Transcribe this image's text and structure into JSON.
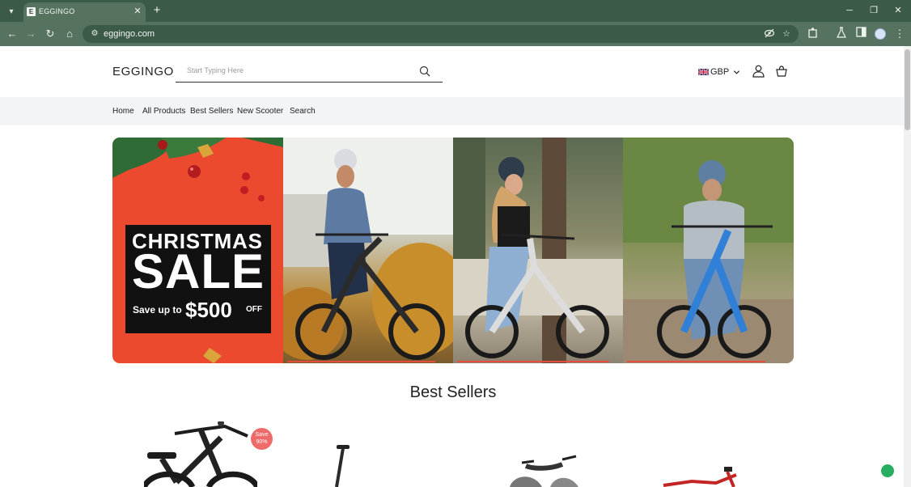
{
  "browser": {
    "tab_title": "EGGINGO",
    "url": "eggingo.com"
  },
  "site": {
    "logo": "EGGINGO",
    "search_placeholder": "Start Typing Here",
    "currency": "GBP",
    "nav": [
      "Home",
      "All Products",
      "Best Sellers",
      "New Scooter",
      "Search"
    ]
  },
  "hero": {
    "headline": "CHRISTMAS",
    "headline2": "SALE",
    "save_up_to": "Save up to",
    "amount": "$500",
    "off": "OFF"
  },
  "best_sellers": {
    "title": "Best Sellers",
    "badge_line1": "Save",
    "badge_line2": "90%"
  },
  "colors": {
    "chrome_dark": "#3c5a48",
    "chrome_light": "#55735f",
    "hero_red": "#ec4a2f",
    "indicator": "#e74c3c",
    "badge": "#ef6a6a",
    "chat": "#27ae60"
  },
  "icons": [
    "tab-search-icon",
    "close-icon",
    "plus-icon",
    "minimize-icon",
    "restore-icon",
    "back-icon",
    "forward-icon",
    "reload-icon",
    "home-icon",
    "tune-icon",
    "eye-off-icon",
    "star-icon",
    "extensions-icon",
    "labs-icon",
    "sidepanel-icon",
    "profile-icon",
    "more-icon",
    "search-icon",
    "chevron-down-icon",
    "account-icon",
    "cart-icon",
    "chat-icon"
  ]
}
